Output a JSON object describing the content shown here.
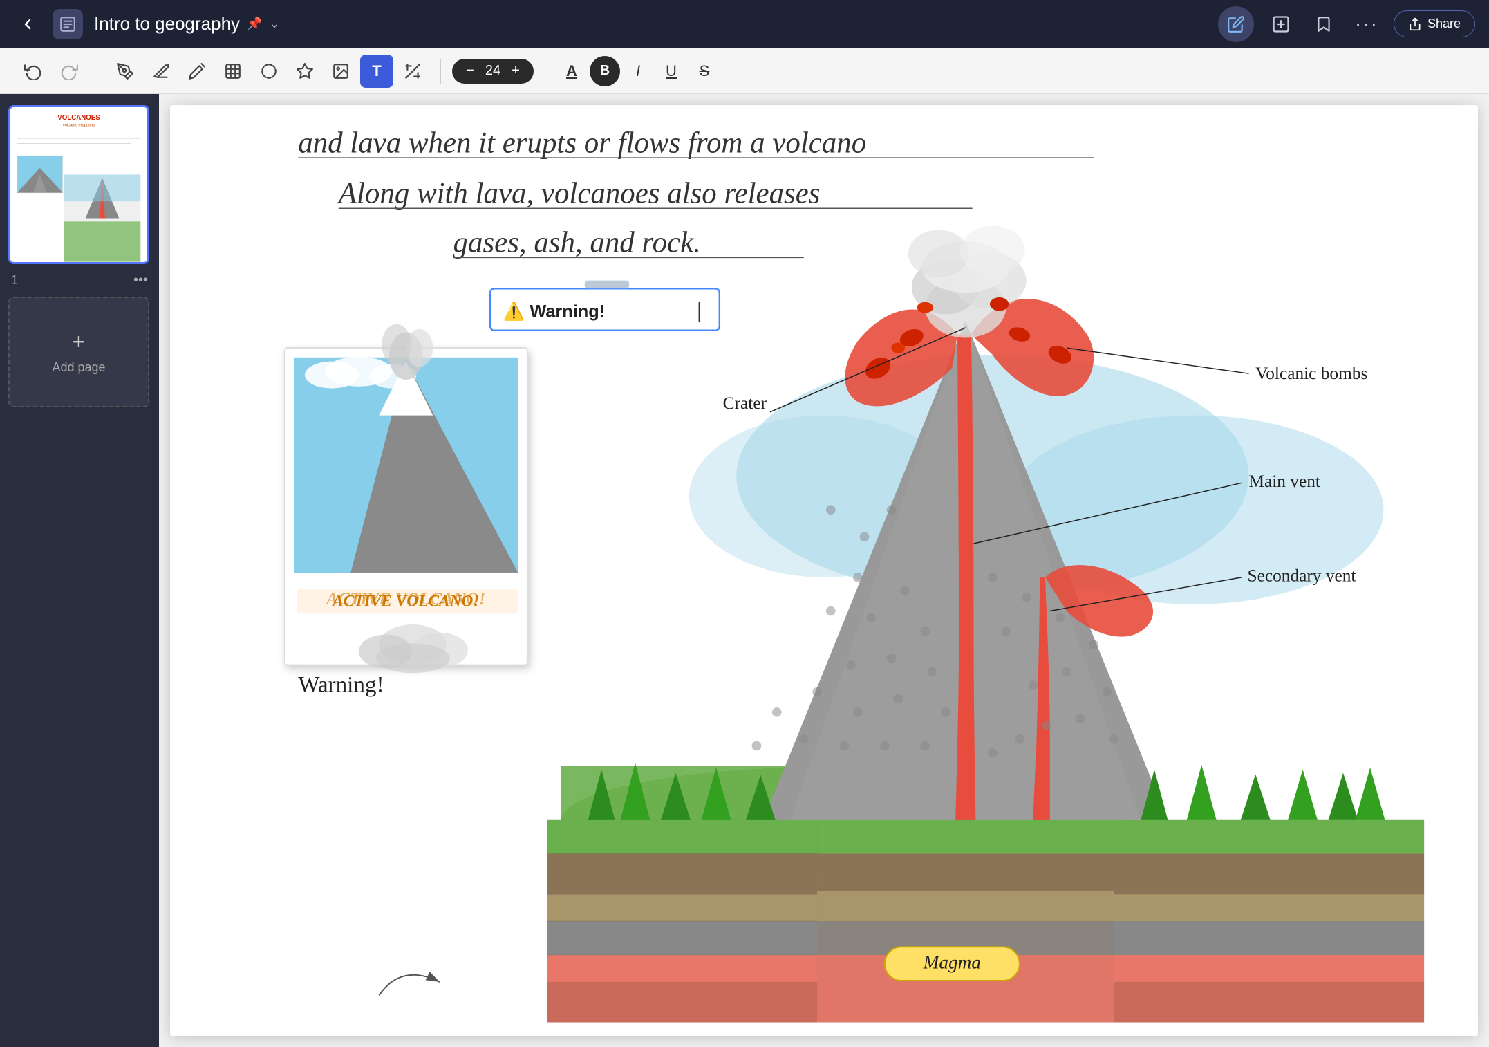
{
  "header": {
    "back_label": "←",
    "doc_icon": "≡",
    "title": "Intro to geography",
    "title_pin": "📌",
    "title_arrow": "⌄",
    "pencil_icon": "✏",
    "add_icon": "+",
    "bookmark_icon": "🔖",
    "more_icon": "•••",
    "share_icon": "↗",
    "share_label": "Share"
  },
  "toolbar": {
    "undo": "↩",
    "redo": "↪",
    "pen": "✏",
    "eraser": "⌫",
    "pencil": "✏",
    "selection": "⊡",
    "lasso": "⊙",
    "star": "★",
    "image": "⊞",
    "text": "T",
    "magic": "✦",
    "font_size": 24,
    "font_size_minus": "−",
    "font_size_plus": "+",
    "text_color": "A",
    "bold": "B",
    "italic": "I",
    "underline": "U",
    "strikethrough": "S"
  },
  "sidebar": {
    "page_number": "1",
    "more_icon": "•••",
    "add_page_plus": "+",
    "add_page_label": "Add page"
  },
  "canvas": {
    "text_line1": "and lava  when it erupts or flows from a volcano",
    "text_line2": "Along with lava, volcanoes also releases",
    "text_line3": "gases, ash, and rock.",
    "warning_label": "⚠️  Warning!",
    "polaroid_label": "ACTIVE VOLCANO!",
    "diagram_labels": {
      "volcanic_bombs": "Volcanic bombs",
      "crater": "Crater",
      "main_vent": "Main vent",
      "secondary_vent": "Secondary vent",
      "magma": "Magma"
    },
    "warning_standalone": "Warning!"
  },
  "colors": {
    "header_bg": "#1e2235",
    "toolbar_bg": "#f5f5f5",
    "sidebar_bg": "#2a2d3e",
    "active_tool": "#3b5bdb",
    "text_active": "#2a2a2a",
    "canvas_bg": "#ffffff"
  }
}
